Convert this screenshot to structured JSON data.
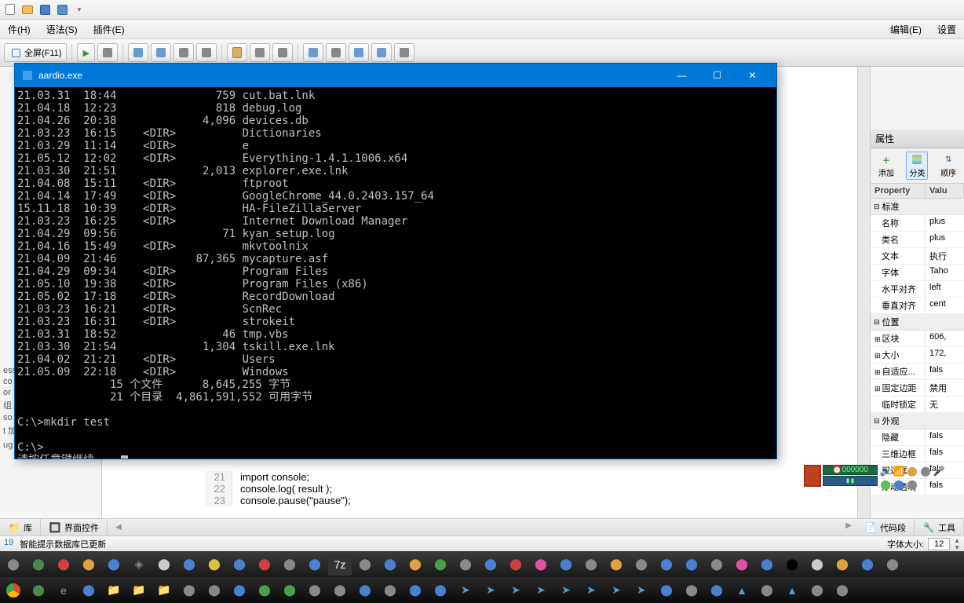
{
  "qat": {
    "icons": [
      "new",
      "open",
      "save",
      "run",
      "dropdown"
    ]
  },
  "menubar": {
    "left": [
      "件(H)",
      "语法(S)",
      "插件(E)"
    ],
    "right": [
      "编辑(E)",
      "设置"
    ]
  },
  "ribbon": {
    "fullscreen": "全屏(F11)"
  },
  "console": {
    "title": "aardio.exe",
    "lines": [
      "21.03.31  18:44               759 cut.bat.lnk",
      "21.04.18  12:23               818 debug.log",
      "21.04.26  20:38             4,096 devices.db",
      "21.03.23  16:15    <DIR>          Dictionaries",
      "21.03.29  11:14    <DIR>          e",
      "21.05.12  12:02    <DIR>          Everything-1.4.1.1006.x64",
      "21.03.30  21:51             2,013 explorer.exe.lnk",
      "21.04.08  15:11    <DIR>          ftproot",
      "21.04.14  17:49    <DIR>          GoogleChrome_44.0.2403.157_64",
      "15.11.18  10:39    <DIR>          HA-FileZillaServer",
      "21.03.23  16:25    <DIR>          Internet Download Manager",
      "21.04.29  09:56                71 kyan_setup.log",
      "21.04.16  15:49    <DIR>          mkvtoolnix",
      "21.04.09  21:46            87,365 mycapture.asf",
      "21.04.29  09:34    <DIR>          Program Files",
      "21.05.10  19:38    <DIR>          Program Files (x86)",
      "21.05.02  17:18    <DIR>          RecordDownload",
      "21.03.23  16:21    <DIR>          ScnRec",
      "21.03.23  16:31    <DIR>          strokeit",
      "21.03.31  18:52                46 tmp.vbs",
      "21.03.30  21:54             1,304 tskill.exe.lnk",
      "21.04.02  21:21    <DIR>          Users",
      "21.05.09  22:18    <DIR>          Windows",
      "              15 个文件      8,645,255 字节",
      "              21 个目录  4,861,591,552 可用字节",
      "",
      "C:\\>mkdir test",
      "",
      "C:\\>",
      "请按任意键继续 ..."
    ]
  },
  "code": {
    "21": "import console;",
    "22": "console.log( result );",
    "23": "console.pause(\"pause\");"
  },
  "left_snips": [
    "ess",
    "co",
    "or",
    "组",
    "so",
    "t 加密解密",
    "ug 调试"
  ],
  "properties": {
    "title": "属性",
    "tools": {
      "add": "添加",
      "category": "分类",
      "order": "顺序"
    },
    "header": {
      "prop": "Property",
      "val": "Valu"
    },
    "groups": {
      "std": "标准",
      "pos": "位置",
      "ext": "外观"
    },
    "rows": {
      "name_k": "名称",
      "name_v": "plus",
      "cls_k": "类名",
      "cls_v": "plus",
      "txt_k": "文本",
      "txt_v": "执行",
      "font_k": "字体",
      "font_v": "Taho",
      "halign_k": "水平对齐",
      "halign_v": "left",
      "valign_k": "垂直对齐",
      "valign_v": "cent",
      "block_k": "区块",
      "block_v": "606,",
      "size_k": "大小",
      "size_v": "172,",
      "auto_k": "自适应...",
      "auto_v": "fals",
      "fixed_k": "固定边距",
      "fixed_v": "禁用",
      "lock_k": "临时锁定",
      "lock_v": "无",
      "hide_k": "隐藏",
      "hide_v": "fals",
      "bor3d_k": "三维边框",
      "bor3d_v": "fals",
      "bor2_k": "双边框",
      "bor2_v": "fals",
      "float_k": "浮动透明",
      "float_v": "fals"
    }
  },
  "bottom_tabs": {
    "left": [
      "库",
      "界面控件"
    ],
    "right": [
      "代码段",
      "工具"
    ]
  },
  "status": {
    "pos": "19",
    "msg": "智能提示数据库已更新",
    "font_label": "字体大小:",
    "font_size": "12"
  },
  "tray": {
    "digits": "000000"
  }
}
